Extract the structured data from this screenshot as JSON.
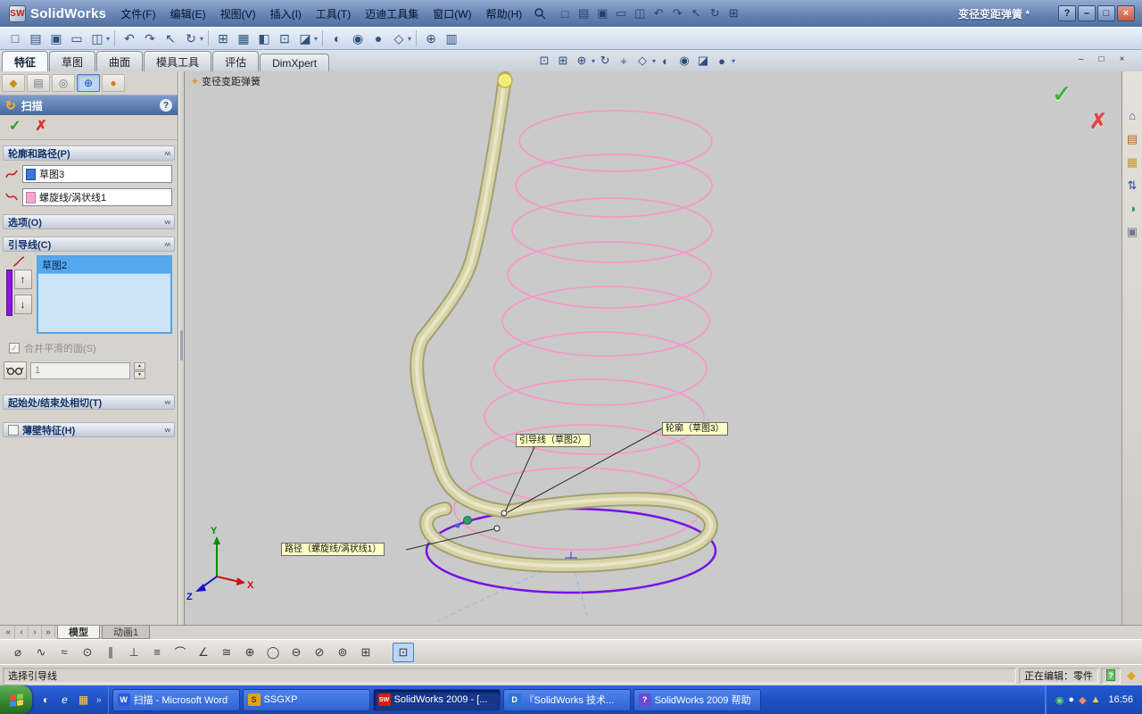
{
  "titlebar": {
    "app_name": "SolidWorks",
    "logo_mark": "SW",
    "doc_title": "变径变距弹簧 *",
    "menus": [
      "文件(F)",
      "编辑(E)",
      "视图(V)",
      "插入(I)",
      "工具(T)",
      "迈迪工具集",
      "窗口(W)",
      "帮助(H)"
    ]
  },
  "feature_tabs": [
    "特征",
    "草图",
    "曲面",
    "模具工具",
    "评估",
    "DimXpert"
  ],
  "property_manager": {
    "title": "扫描",
    "profile_path_label": "轮廓和路径(P)",
    "profile_value": "草图3",
    "path_value": "螺旋线/涡状线1",
    "options_label": "选项(O)",
    "guide_label": "引导线(C)",
    "guide_value": "草图2",
    "merge_label": "合并平滑的面(S)",
    "tangency_value": "1",
    "start_end_label": "起始处/结束处相切(T)",
    "thin_label": "薄壁特征(H)"
  },
  "viewport": {
    "breadcrumb": "变径变距弹簧",
    "callout_guide": "引导线（草图2）",
    "callout_profile": "轮廓（草图3）",
    "callout_path": "路径（螺旋线/涡状线1）",
    "axis_x": "X",
    "axis_y": "Y",
    "axis_z": "Z"
  },
  "bottom_tabs": {
    "model": "模型",
    "animation": "动画1"
  },
  "status_bar": {
    "left": "选择引导线",
    "editing": "正在编辑：零件",
    "help_glyph": "?"
  },
  "taskbar": {
    "buttons": [
      "扫描 - Microsoft Word",
      "SSGXP",
      "SolidWorks 2009 - [...",
      "『SolidWorks 技术...",
      "SolidWorks 2009 帮助"
    ],
    "button_chips": [
      "W",
      "S",
      "SW",
      "D",
      "?"
    ],
    "time": "16:56"
  },
  "colors": {
    "helix_pink": "#ff93c8",
    "path_purple": "#7a10e8",
    "tube_tan": "#d7d3a6",
    "selection_blue": "#56a8ee",
    "taskbar_blue": "#2f66dd"
  },
  "icons": {
    "help": "?",
    "minimize": "–",
    "maximize": "□",
    "close": "×",
    "chevron_up": "∧∧",
    "chevron_down": "∨∨",
    "arrow_up": "↑",
    "arrow_down": "↓",
    "ok": "✓",
    "cancel": "✗",
    "dropdown": "▾",
    "nav_first": "«",
    "nav_prev": "‹",
    "nav_next": "›",
    "nav_last": "»",
    "spin_up": "▲",
    "spin_down": "▼",
    "sweep": "↻",
    "breadcrumb_plus": "+",
    "titlebar_tools": [
      "□",
      "▤",
      "▣",
      "▭",
      "◫",
      "↶",
      "↷",
      "↖",
      "↻",
      "⊞"
    ],
    "main_tools": [
      "□",
      "▤",
      "▣",
      "▭",
      "◫",
      "↶",
      "↷",
      "↖",
      "↻",
      "⊞",
      "▦",
      "◧",
      "⊡",
      "◪",
      "◐",
      "◉",
      "●",
      "◇",
      "⊕",
      "▥"
    ],
    "view_tools": [
      "⊡",
      "⊞",
      "⊕",
      "↻",
      "+",
      "◇",
      "◐",
      "◉",
      "◪",
      "●"
    ],
    "pm_tabs": [
      "◆",
      "▤",
      "◎",
      "⊕",
      "●"
    ],
    "task_pane": [
      "⌂",
      "▤",
      "▦",
      "⇅",
      "◑",
      "▣"
    ],
    "sketch_tools": [
      "⌀",
      "∿",
      "≈",
      "⊙",
      "∥",
      "⊥",
      "≡",
      "⌒",
      "∠",
      "≅",
      "⊕",
      "◯",
      "⊖",
      "⊘",
      "⊚",
      "⊞",
      "⊡"
    ],
    "quick_launch": [
      "◐",
      "e",
      "▦"
    ],
    "tray": [
      "◉",
      "●",
      "◆",
      "▲"
    ]
  }
}
